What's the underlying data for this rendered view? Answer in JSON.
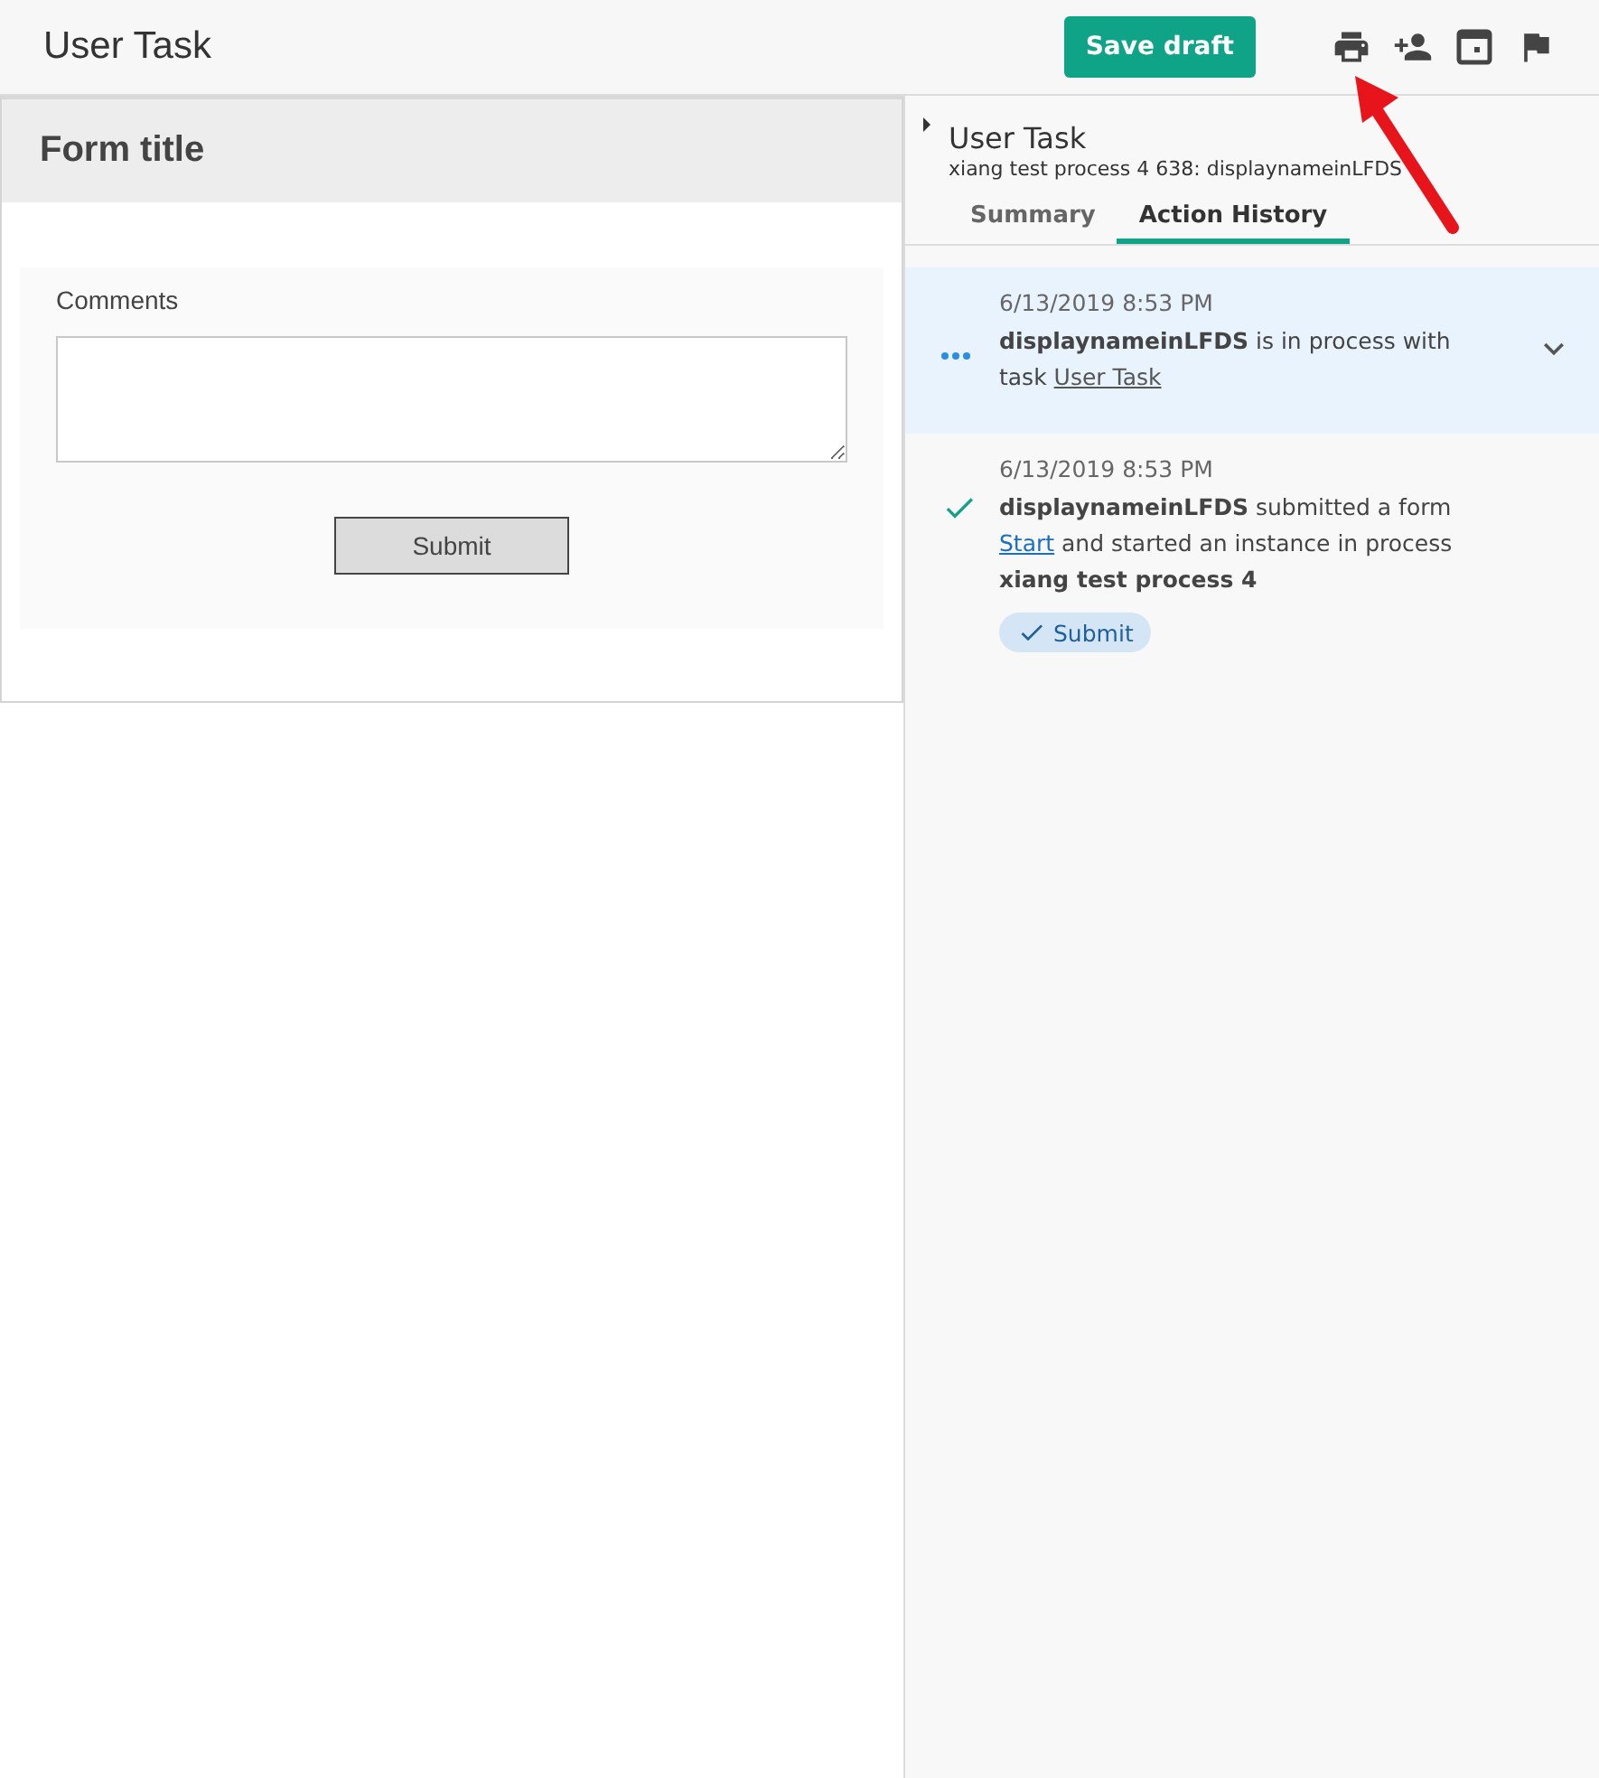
{
  "header": {
    "title": "User Task",
    "save_button": "Save draft"
  },
  "form": {
    "title": "Form title",
    "field_label": "Comments",
    "submit": "Submit"
  },
  "details": {
    "title": "User Task",
    "subtitle": "xiang test process 4 638: displaynameinLFDS",
    "tabs": [
      {
        "label": "Summary",
        "selected": false
      },
      {
        "label": "Action History",
        "selected": true
      }
    ],
    "history": [
      {
        "kind": "in_progress",
        "selected": true,
        "expanded": false,
        "time": "6/13/2019 8:53 PM",
        "text_before": "**displaynameinLFDS** is in process with task",
        "link": "User Task"
      },
      {
        "kind": "completed",
        "selected": false,
        "time": "6/13/2019 8:53 PM",
        "text_before": "**displaynameinLFDS** submitted a form ",
        "link": "Start",
        "text_after": " and started an instance in process **xiang test process 4**",
        "badge": "Submit"
      }
    ]
  }
}
